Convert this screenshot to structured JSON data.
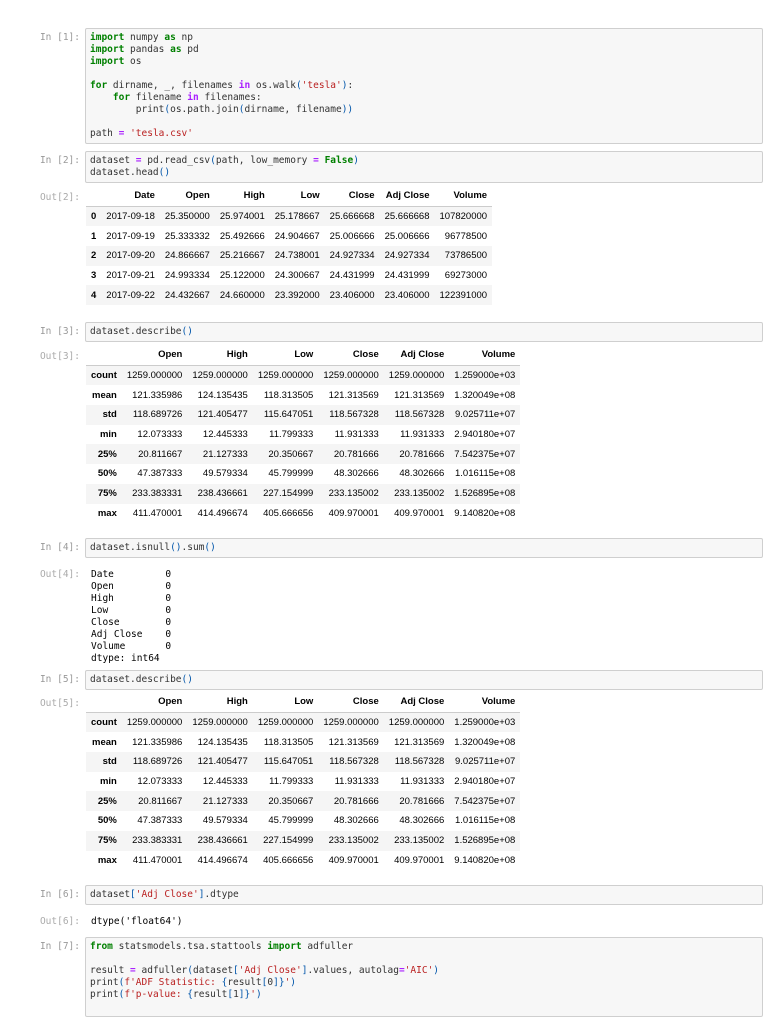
{
  "colors": {
    "keyword": "#008000",
    "operator": "#aa22ff",
    "string": "#ba2121",
    "paren": "#0055aa"
  },
  "cells": [
    {
      "kind": "input",
      "prompt": "In [1]:",
      "lines": [
        [
          [
            "k",
            "import"
          ],
          " numpy ",
          [
            "k",
            "as"
          ],
          " np"
        ],
        [
          [
            "k",
            "import"
          ],
          " pandas ",
          [
            "k",
            "as"
          ],
          " pd"
        ],
        [
          [
            "k",
            "import"
          ],
          " os"
        ],
        [
          ""
        ],
        [
          [
            "k",
            "for"
          ],
          " dirname, _, filenames ",
          [
            "o",
            "in"
          ],
          " os.walk",
          [
            "p",
            "("
          ],
          [
            "s",
            "'tesla'"
          ],
          [
            "p",
            ")"
          ],
          ":"
        ],
        [
          "    ",
          [
            "k",
            "for"
          ],
          " filename ",
          [
            "o",
            "in"
          ],
          " filenames:"
        ],
        [
          "        print",
          [
            "p",
            "("
          ],
          "os.path.join",
          [
            "p",
            "("
          ],
          "dirname, filename",
          [
            "p",
            "))"
          ]
        ],
        [
          ""
        ],
        [
          "path ",
          [
            "o",
            "="
          ],
          " ",
          [
            "s",
            "'tesla.csv'"
          ]
        ]
      ]
    },
    {
      "kind": "input",
      "prompt": "In [2]:",
      "lines": [
        [
          "dataset ",
          [
            "o",
            "="
          ],
          " pd.read_csv",
          [
            "p",
            "("
          ],
          "path, low_memory ",
          [
            "o",
            "="
          ],
          " ",
          [
            "k",
            "False"
          ],
          [
            "p",
            ")"
          ]
        ],
        [
          "dataset.head",
          [
            "p",
            "()"
          ]
        ]
      ]
    },
    {
      "kind": "table",
      "prompt": "Out[2]:",
      "columns": [
        "",
        "Date",
        "Open",
        "High",
        "Low",
        "Close",
        "Adj Close",
        "Volume"
      ],
      "rows": [
        [
          "0",
          "2017-09-18",
          "25.350000",
          "25.974001",
          "25.178667",
          "25.666668",
          "25.666668",
          "107820000"
        ],
        [
          "1",
          "2017-09-19",
          "25.333332",
          "25.492666",
          "24.904667",
          "25.006666",
          "25.006666",
          "96778500"
        ],
        [
          "2",
          "2017-09-20",
          "24.866667",
          "25.216667",
          "24.738001",
          "24.927334",
          "24.927334",
          "73786500"
        ],
        [
          "3",
          "2017-09-21",
          "24.993334",
          "25.122000",
          "24.300667",
          "24.431999",
          "24.431999",
          "69273000"
        ],
        [
          "4",
          "2017-09-22",
          "24.432667",
          "24.660000",
          "23.392000",
          "23.406000",
          "23.406000",
          "122391000"
        ]
      ]
    },
    {
      "kind": "input",
      "prompt": "In [3]:",
      "lines": [
        [
          "dataset.describe",
          [
            "p",
            "()"
          ]
        ]
      ]
    },
    {
      "kind": "table",
      "prompt": "Out[3]:",
      "columns": [
        "",
        "Open",
        "High",
        "Low",
        "Close",
        "Adj Close",
        "Volume"
      ],
      "rows": [
        [
          "count",
          "1259.000000",
          "1259.000000",
          "1259.000000",
          "1259.000000",
          "1259.000000",
          "1.259000e+03"
        ],
        [
          "mean",
          "121.335986",
          "124.135435",
          "118.313505",
          "121.313569",
          "121.313569",
          "1.320049e+08"
        ],
        [
          "std",
          "118.689726",
          "121.405477",
          "115.647051",
          "118.567328",
          "118.567328",
          "9.025711e+07"
        ],
        [
          "min",
          "12.073333",
          "12.445333",
          "11.799333",
          "11.931333",
          "11.931333",
          "2.940180e+07"
        ],
        [
          "25%",
          "20.811667",
          "21.127333",
          "20.350667",
          "20.781666",
          "20.781666",
          "7.542375e+07"
        ],
        [
          "50%",
          "47.387333",
          "49.579334",
          "45.799999",
          "48.302666",
          "48.302666",
          "1.016115e+08"
        ],
        [
          "75%",
          "233.383331",
          "238.436661",
          "227.154999",
          "233.135002",
          "233.135002",
          "1.526895e+08"
        ],
        [
          "max",
          "411.470001",
          "414.496674",
          "405.666656",
          "409.970001",
          "409.970001",
          "9.140820e+08"
        ]
      ]
    },
    {
      "kind": "input",
      "prompt": "In [4]:",
      "lines": [
        [
          "dataset.isnull",
          [
            "p",
            "()"
          ],
          ".sum",
          [
            "p",
            "()"
          ]
        ]
      ]
    },
    {
      "kind": "text",
      "prompt": "Out[4]:",
      "text": "Date         0\nOpen         0\nHigh         0\nLow          0\nClose        0\nAdj Close    0\nVolume       0\ndtype: int64"
    },
    {
      "kind": "input",
      "prompt": "In [5]:",
      "lines": [
        [
          "dataset.describe",
          [
            "p",
            "()"
          ]
        ]
      ]
    },
    {
      "kind": "table",
      "prompt": "Out[5]:",
      "columns": [
        "",
        "Open",
        "High",
        "Low",
        "Close",
        "Adj Close",
        "Volume"
      ],
      "rows": [
        [
          "count",
          "1259.000000",
          "1259.000000",
          "1259.000000",
          "1259.000000",
          "1259.000000",
          "1.259000e+03"
        ],
        [
          "mean",
          "121.335986",
          "124.135435",
          "118.313505",
          "121.313569",
          "121.313569",
          "1.320049e+08"
        ],
        [
          "std",
          "118.689726",
          "121.405477",
          "115.647051",
          "118.567328",
          "118.567328",
          "9.025711e+07"
        ],
        [
          "min",
          "12.073333",
          "12.445333",
          "11.799333",
          "11.931333",
          "11.931333",
          "2.940180e+07"
        ],
        [
          "25%",
          "20.811667",
          "21.127333",
          "20.350667",
          "20.781666",
          "20.781666",
          "7.542375e+07"
        ],
        [
          "50%",
          "47.387333",
          "49.579334",
          "45.799999",
          "48.302666",
          "48.302666",
          "1.016115e+08"
        ],
        [
          "75%",
          "233.383331",
          "238.436661",
          "227.154999",
          "233.135002",
          "233.135002",
          "1.526895e+08"
        ],
        [
          "max",
          "411.470001",
          "414.496674",
          "405.666656",
          "409.970001",
          "409.970001",
          "9.140820e+08"
        ]
      ]
    },
    {
      "kind": "input",
      "prompt": "In [6]:",
      "lines": [
        [
          "dataset",
          [
            "p",
            "["
          ],
          [
            "s",
            "'Adj Close'"
          ],
          [
            "p",
            "]"
          ],
          ".dtype"
        ]
      ]
    },
    {
      "kind": "text",
      "prompt": "Out[6]:",
      "text": "dtype('float64')"
    },
    {
      "kind": "input",
      "prompt": "In [7]:",
      "lines": [
        [
          [
            "k",
            "from"
          ],
          " statsmodels.tsa.stattools ",
          [
            "k",
            "import"
          ],
          " adfuller"
        ],
        [
          ""
        ],
        [
          "result ",
          [
            "o",
            "="
          ],
          " adfuller",
          [
            "p",
            "("
          ],
          "dataset",
          [
            "p",
            "["
          ],
          [
            "s",
            "'Adj Close'"
          ],
          [
            "p",
            "]"
          ],
          ".values, autolag",
          [
            "o",
            "="
          ],
          [
            "s",
            "'AIC'"
          ],
          [
            "p",
            ")"
          ]
        ],
        [
          "print",
          [
            "p",
            "("
          ],
          [
            "s",
            "f'ADF Statistic: "
          ],
          [
            "p",
            "{"
          ],
          "result",
          [
            "p",
            "["
          ],
          "0",
          [
            "p",
            "]}"
          ],
          [
            "s",
            "'"
          ],
          [
            "p",
            ")"
          ]
        ],
        [
          "print",
          [
            "p",
            "("
          ],
          [
            "s",
            "f'p-value: "
          ],
          [
            "p",
            "{"
          ],
          "result",
          [
            "p",
            "["
          ],
          "1",
          [
            "p",
            "]}"
          ],
          [
            "s",
            "'"
          ],
          [
            "p",
            ")"
          ]
        ],
        [
          ""
        ]
      ]
    }
  ]
}
